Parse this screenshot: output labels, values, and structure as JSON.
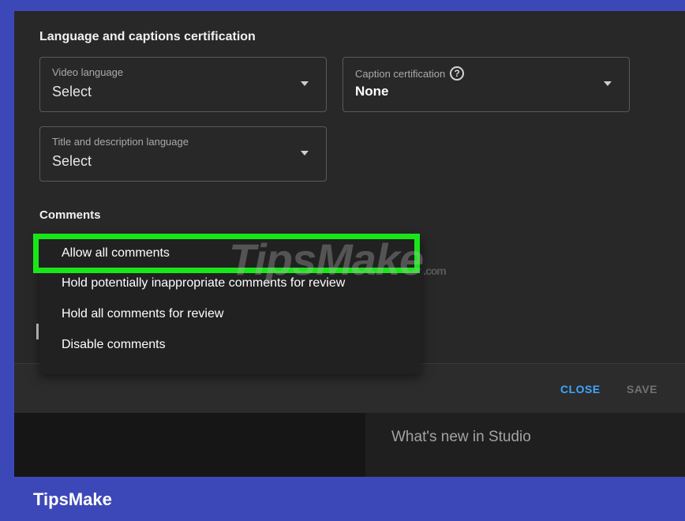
{
  "dialog": {
    "lang_section_title": "Language and captions certification",
    "comments_section_title": "Comments"
  },
  "fields": {
    "video_language": {
      "label": "Video language",
      "value": "Select"
    },
    "caption_certification": {
      "label": "Caption certification",
      "value": "None",
      "help_icon": "help-circle-icon"
    },
    "title_description_language": {
      "label": "Title and description language",
      "value": "Select"
    }
  },
  "comments_menu": {
    "items": [
      {
        "label": "Allow all comments",
        "selected": true
      },
      {
        "label": "Hold potentially inappropriate comments for review"
      },
      {
        "label": "Hold all comments for review"
      },
      {
        "label": "Disable comments"
      }
    ]
  },
  "footer": {
    "close_label": "CLOSE",
    "save_label": "SAVE"
  },
  "background": {
    "whats_new": "What's new in Studio"
  },
  "watermark": {
    "text": "TipsMake",
    "suffix": ".com"
  },
  "brand": {
    "text": "TipsMake"
  },
  "colors": {
    "highlight": "#19e619",
    "close": "#3ea6ff",
    "save_disabled": "#717171",
    "brand_bg": "#3d48b8"
  }
}
